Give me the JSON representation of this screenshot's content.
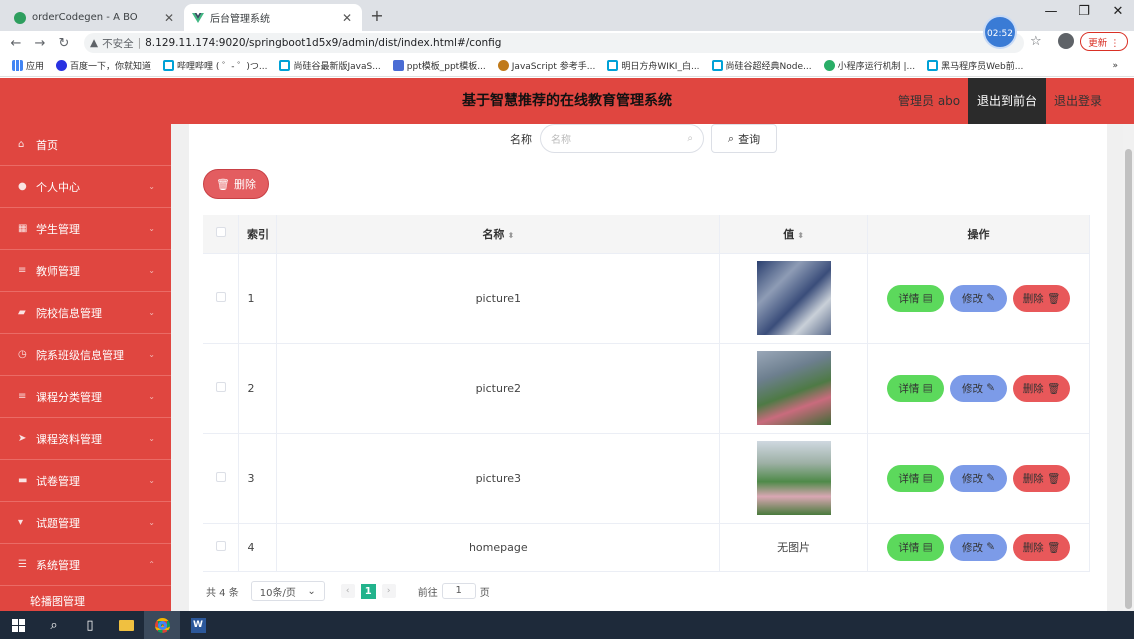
{
  "browser": {
    "tabs": [
      {
        "title": "orderCodegen - A BO",
        "close": "✕"
      },
      {
        "title": "后台管理系统",
        "close": "✕"
      }
    ],
    "new_tab": "+",
    "window_controls": {
      "minimize": "—",
      "maximize": "❐",
      "close": "✕"
    },
    "address": {
      "security_label": "不安全",
      "url": "8.129.11.174:9020/springboot1d5x9/admin/dist/index.html#/config"
    },
    "clock": "02:52",
    "update_button": "更新 ⋮",
    "bookmarks": [
      "应用",
      "百度一下，你就知道",
      "哔哩哔哩 ( ゜- ゜)つ...",
      "尚硅谷最新版JavaS...",
      "ppt模板_ppt模板...",
      "JavaScript 参考手...",
      "明日方舟WIKI_白...",
      "尚硅谷超经典Node...",
      "小程序运行机制 |...",
      "黑马程序员Web前..."
    ],
    "bookmarks_more": "»"
  },
  "header": {
    "title": "基于智慧推荐的在线教育管理系统",
    "user": "管理员 abo",
    "front_link": "退出到前台",
    "logout": "退出登录"
  },
  "sidebar": {
    "items": [
      {
        "label": "首页",
        "icon": "home-icon",
        "glyph": "⌂",
        "arrow": ""
      },
      {
        "label": "个人中心",
        "icon": "user-icon",
        "glyph": "●",
        "arrow": "⌄"
      },
      {
        "label": "学生管理",
        "icon": "grid-icon",
        "glyph": "▦",
        "arrow": "⌄"
      },
      {
        "label": "教师管理",
        "icon": "menu-icon",
        "glyph": "≡",
        "arrow": "⌄"
      },
      {
        "label": "院校信息管理",
        "icon": "tag-icon",
        "glyph": "▰",
        "arrow": "⌄"
      },
      {
        "label": "院系班级信息管理",
        "icon": "clock-icon",
        "glyph": "◷",
        "arrow": "⌄"
      },
      {
        "label": "课程分类管理",
        "icon": "list-icon",
        "glyph": "≡",
        "arrow": "⌄"
      },
      {
        "label": "课程资料管理",
        "icon": "send-icon",
        "glyph": "➤",
        "arrow": "⌄"
      },
      {
        "label": "试卷管理",
        "icon": "chat-icon",
        "glyph": "▬",
        "arrow": "⌄"
      },
      {
        "label": "试题管理",
        "icon": "pin-icon",
        "glyph": "▾",
        "arrow": "⌄"
      },
      {
        "label": "系统管理",
        "icon": "settings-icon",
        "glyph": "☰",
        "arrow": "⌃"
      }
    ],
    "subitem": "轮播图管理"
  },
  "search": {
    "label": "名称",
    "placeholder": "名称",
    "button": "查询"
  },
  "toolbar": {
    "delete": "删除"
  },
  "table": {
    "headers": {
      "index": "索引",
      "name": "名称",
      "value": "值",
      "actions": "操作"
    },
    "rows": [
      {
        "index": "1",
        "name": "picture1",
        "value": "",
        "has_image": true
      },
      {
        "index": "2",
        "name": "picture2",
        "value": "",
        "has_image": true
      },
      {
        "index": "3",
        "name": "picture3",
        "value": "",
        "has_image": true
      },
      {
        "index": "4",
        "name": "homepage",
        "value": "无图片",
        "has_image": false
      }
    ],
    "actions": {
      "detail": "详情",
      "edit": "修改",
      "delete": "删除"
    }
  },
  "pagination": {
    "total": "共 4 条",
    "page_size": "10条/页",
    "current": "1",
    "goto_label": "前往",
    "goto_value": "1",
    "page_suffix": "页"
  },
  "colors": {
    "primary": "#e04640",
    "detail": "#5cd95c",
    "edit": "#7c9be8",
    "delete": "#e8585a",
    "page_active": "#22b38c"
  }
}
